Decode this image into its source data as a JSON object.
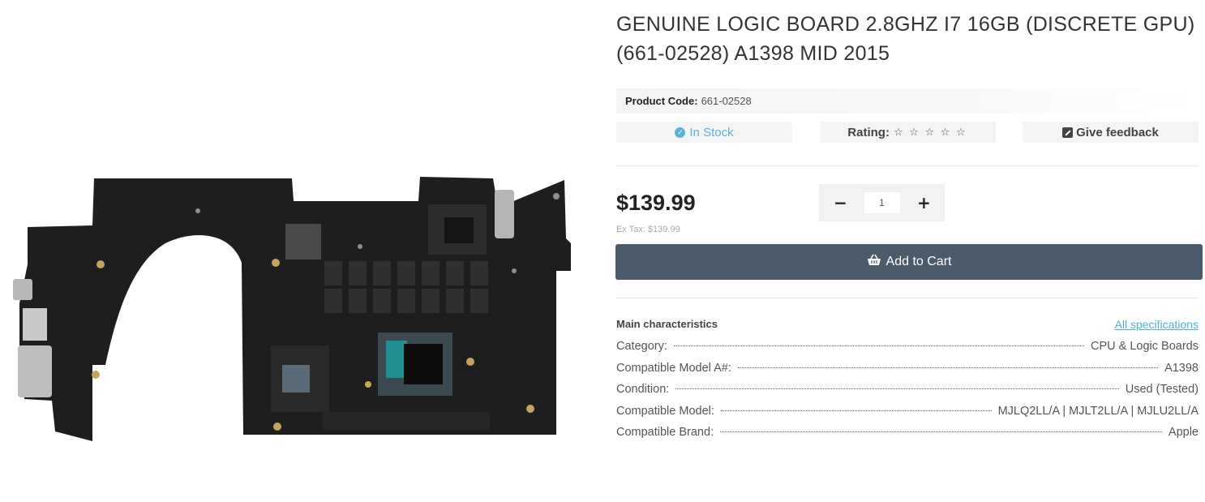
{
  "product": {
    "title_line1": "GENUINE LOGIC BOARD 2.8GHZ I7 16GB (DISCRETE GPU)",
    "title_line2": "(661-02528) A1398 MID 2015",
    "code_label": "Product Code:",
    "code_value": "661-02528",
    "stock_text": "In Stock",
    "rating_label": "Rating:",
    "rating_stars": "☆ ☆ ☆ ☆ ☆",
    "rating_value": 0,
    "rating_max": 5,
    "feedback_label": "Give feedback",
    "price": "$139.99",
    "ex_tax": "Ex Tax: $139.99",
    "quantity": "1",
    "minus_label": "−",
    "plus_label": "+",
    "add_to_cart_label": "Add to Cart"
  },
  "characteristics": {
    "title": "Main characteristics",
    "all_specs_link": "All specifications",
    "rows": [
      {
        "label": "Category:",
        "value": "CPU & Logic Boards"
      },
      {
        "label": "Compatible Model A#:",
        "value": "A1398"
      },
      {
        "label": "Condition:",
        "value": "Used (Tested)"
      },
      {
        "label": "Compatible Model:",
        "value": "MJLQ2LL/A | MJLT2LL/A | MJLU2LL/A"
      },
      {
        "label": "Compatible Brand:",
        "value": "Apple"
      }
    ]
  },
  "colors": {
    "accent": "#5fb0d8",
    "cart_button": "#4b5b6c",
    "board": "#1d1d1d"
  },
  "icons": {
    "stock": "check-circle-icon",
    "feedback": "edit-icon",
    "cart": "basket-icon"
  }
}
